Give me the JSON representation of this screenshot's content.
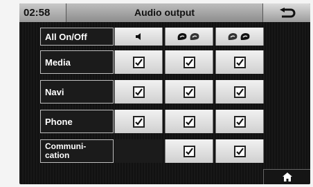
{
  "header": {
    "clock": "02:58",
    "title": "Audio output"
  },
  "columns": [
    {
      "icon": "speaker-icon"
    },
    {
      "icon": "front-speakers-icon"
    },
    {
      "icon": "rear-speakers-icon"
    }
  ],
  "all_toggle": {
    "label": "All On/Off"
  },
  "rows": [
    {
      "label": "Media",
      "checks": [
        true,
        true,
        true
      ]
    },
    {
      "label": "Navi",
      "checks": [
        true,
        true,
        true
      ]
    },
    {
      "label": "Phone",
      "checks": [
        true,
        true,
        true
      ]
    },
    {
      "label": "Communi-\ncation",
      "checks": [
        null,
        true,
        true
      ]
    }
  ],
  "nav": {
    "back_icon": "back-arrow-icon",
    "home_icon": "home-icon"
  }
}
